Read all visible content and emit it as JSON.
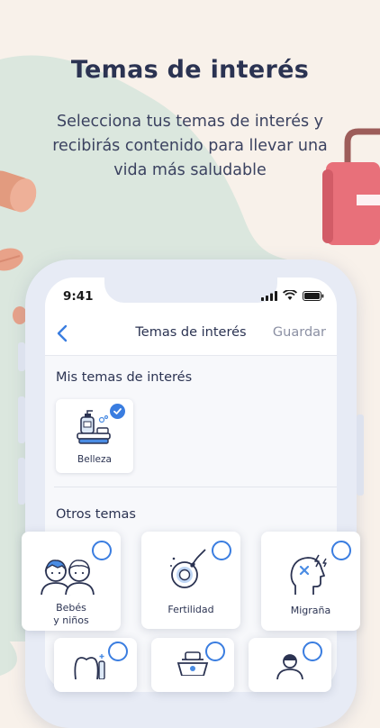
{
  "promo": {
    "title": "Temas de interés",
    "subtitle": "Selecciona tus temas de interés y recibirás contenido para llevar una vida más saludable"
  },
  "status_bar": {
    "time": "9:41"
  },
  "nav": {
    "title": "Temas de interés",
    "save_label": "Guardar"
  },
  "my_topics": {
    "title": "Mis temas de interés",
    "items": [
      {
        "label": "Belleza",
        "icon": "beauty-products-icon",
        "selected": true
      }
    ]
  },
  "other_topics": {
    "title": "Otros temas",
    "items": [
      {
        "label": "Bebés\ny niños",
        "icon": "children-icon",
        "selected": false
      },
      {
        "label": "Fertilidad",
        "icon": "fertility-icon",
        "selected": false
      },
      {
        "label": "Migraña",
        "icon": "migraine-icon",
        "selected": false
      },
      {
        "label": "",
        "icon": "dental-icon",
        "selected": false
      },
      {
        "label": "",
        "icon": "scale-icon",
        "selected": false
      },
      {
        "label": "",
        "icon": "doctor-icon",
        "selected": false
      }
    ]
  },
  "colors": {
    "background": "#f8f1ea",
    "accent_blue": "#3a7de0",
    "text_dark": "#2b3352",
    "blob_teal": "#dbe7de",
    "first_aid_pink": "#e8707a"
  }
}
